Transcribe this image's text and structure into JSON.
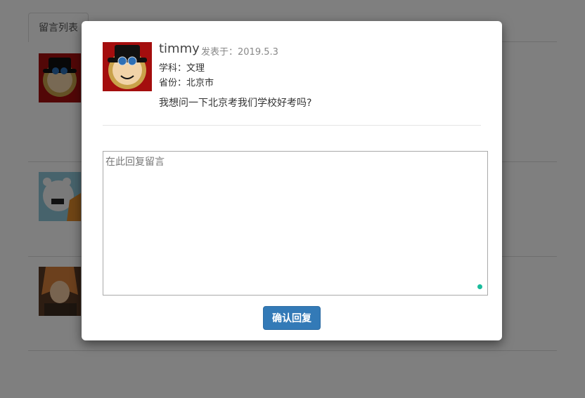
{
  "background": {
    "tab_label": "留言列表"
  },
  "modal": {
    "user_name": "timmy",
    "posted_at": "发表于：2019.5.3",
    "subject": "学科：文理",
    "province": "省份：北京市",
    "message": "我想问一下北京考我们学校好考吗?",
    "reply_placeholder": "在此回复留言",
    "confirm_label": "确认回复"
  },
  "colors": {
    "overlay": "rgba(0,0,0,0.5)",
    "primary_button": "#337ab7",
    "resize_indicator": "#1abc9c"
  }
}
